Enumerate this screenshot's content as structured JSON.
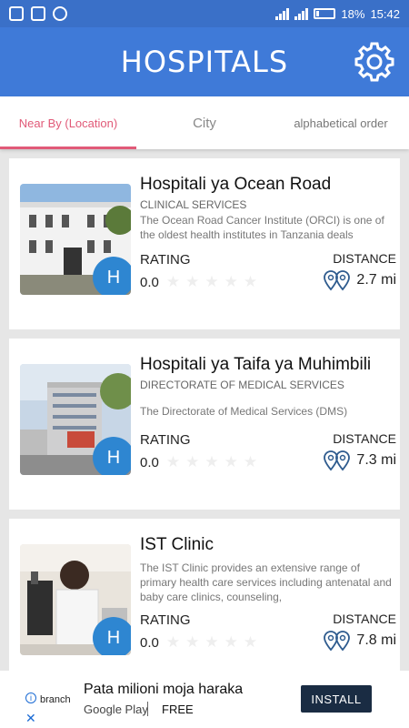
{
  "status_bar": {
    "battery": "18%",
    "time": "15:42"
  },
  "app_bar": {
    "title": "HOSPITALS",
    "settings_icon": "gear-icon"
  },
  "tabs": [
    {
      "label": "Near By (Location)",
      "active": true
    },
    {
      "label": "City",
      "active": false
    },
    {
      "label": "alphabetical order",
      "active": false
    }
  ],
  "hospitals": [
    {
      "name": "Hospitali ya Ocean Road",
      "category": "CLINICAL SERVICES",
      "description": "The Ocean Road Cancer Institute (ORCI) is one of the oldest health institutes in Tanzania deals",
      "rating_label": "RATING",
      "rating": "0.0",
      "distance_label": "DISTANCE",
      "distance": "2.7 mi",
      "badge": "H"
    },
    {
      "name": "Hospitali ya Taifa ya Muhimbili",
      "category": "DIRECTORATE OF MEDICAL SERVICES",
      "description": "The Directorate of Medical Services (DMS)",
      "rating_label": "RATING",
      "rating": "0.0",
      "distance_label": "DISTANCE",
      "distance": "7.3 mi",
      "badge": "H"
    },
    {
      "name": "IST Clinic",
      "category": "",
      "description": "The IST Clinic provides an extensive range of primary health care services including antenatal and baby care clinics, counseling,",
      "rating_label": "RATING",
      "rating": "0.0",
      "distance_label": "DISTANCE",
      "distance": "7.8 mi",
      "badge": "H"
    }
  ],
  "ad": {
    "brand": "branch",
    "title": "Pata milioni moja haraka",
    "store": "Google Play",
    "price": "FREE",
    "install_label": "INSTALL"
  },
  "colors": {
    "primary": "#3f7ad8",
    "accent": "#e15a78",
    "badge": "#2e86d1"
  }
}
